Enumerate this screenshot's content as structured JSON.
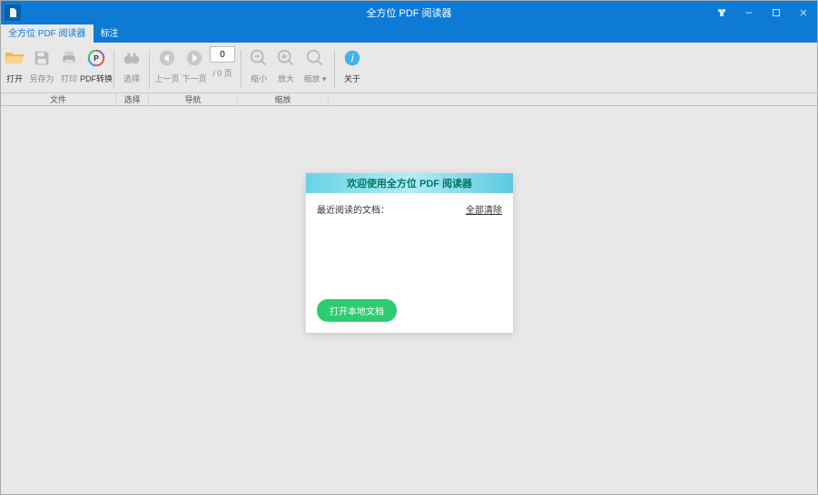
{
  "app": {
    "title": "全方位 PDF 阅读器"
  },
  "tabs": {
    "reader": "全方位 PDF 阅读器",
    "annotate": "标注"
  },
  "toolbar": {
    "open": "打开",
    "saveas": "另存为",
    "print": "打印",
    "convert": "PDF转换",
    "select": "选择",
    "prev": "上一页",
    "next": "下一页",
    "pagetotal": "/ 0 页",
    "zoomout": "缩小",
    "zoomin": "放大",
    "fit": "缩放",
    "about": "关于",
    "page_value": "0"
  },
  "groups": {
    "file": "文件",
    "select": "选择",
    "nav": "导航",
    "zoom": "缩放"
  },
  "welcome": {
    "title": "欢迎使用全方位 PDF 阅读器",
    "recent_label": "最近阅读的文档：",
    "clear": "全部清除",
    "open_local": "打开本地文档"
  }
}
